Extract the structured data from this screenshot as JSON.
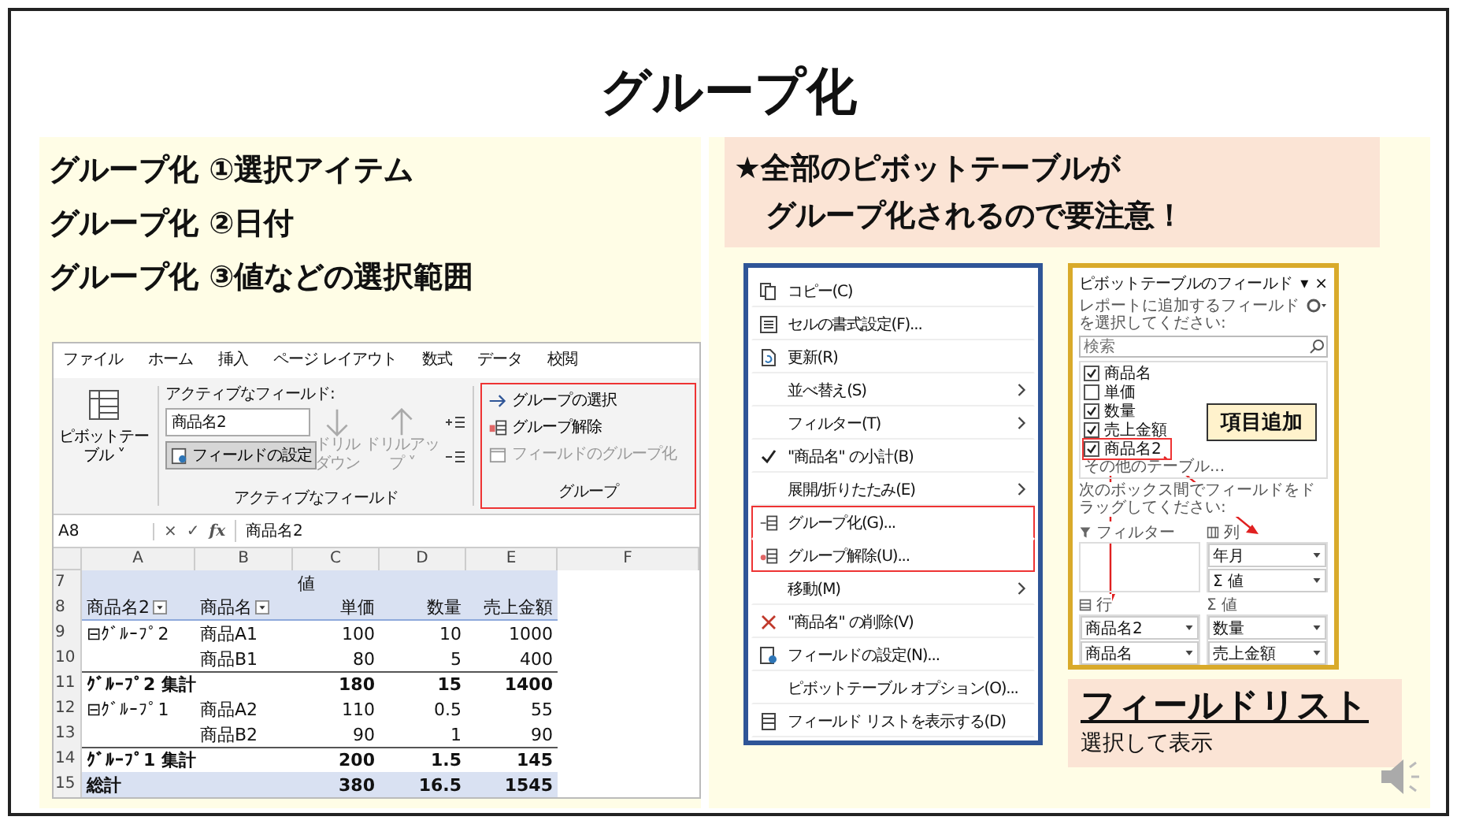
{
  "title": "グループ化",
  "points": [
    "グループ化 ①選択アイテム",
    "グループ化 ②日付",
    "グループ化 ③値などの選択範囲"
  ],
  "notice": [
    "★全部のピボットテーブルが",
    "グループ化されるので要注意！"
  ],
  "ribbon": {
    "tabs": [
      "ファイル",
      "ホーム",
      "挿入",
      "ページ レイアウト",
      "数式",
      "データ",
      "校閲"
    ],
    "pivot_button": [
      "ピボットテー",
      "ブル ˅"
    ],
    "active_field_label": "アクティブなフィールド:",
    "active_field_value": "商品名2",
    "field_settings": "フィールドの設定",
    "drill_down": [
      "ドリル",
      "ダウン"
    ],
    "drill_up": [
      "ドリルアッ",
      "プ ˅"
    ],
    "active_group_label": "アクティブなフィールド",
    "group_commands": [
      {
        "label": "グループの選択",
        "kind": "select",
        "disabled": false
      },
      {
        "label": "グループ解除",
        "kind": "ungroup",
        "disabled": false
      },
      {
        "label": "フィールドのグループ化",
        "kind": "group",
        "disabled": true
      }
    ],
    "group_label": "グループ"
  },
  "formula_bar": {
    "name_box": "A8",
    "cancel": "×",
    "enter": "✓",
    "function": "fx",
    "formula": "商品名2"
  },
  "sheet": {
    "columns": [
      "A",
      "B",
      "C",
      "D",
      "E",
      "F"
    ],
    "rows": [
      {
        "number": "7",
        "kind": "band",
        "cells": [
          null,
          null,
          {
            "text": "値"
          },
          null,
          null
        ]
      },
      {
        "number": "8",
        "kind": "header",
        "cells": [
          {
            "text": "商品名2",
            "dropdown": true
          },
          {
            "text": "商品名",
            "dropdown": true
          },
          {
            "text": "単価"
          },
          {
            "text": "数量"
          },
          {
            "text": "売上金額"
          }
        ]
      },
      {
        "number": "9",
        "kind": "item",
        "cells": [
          {
            "text": "⊟ｸﾞﾙｰﾌﾟ2"
          },
          {
            "text": "商品A1"
          },
          {
            "text": "100"
          },
          {
            "text": "10"
          },
          {
            "text": "1000"
          }
        ]
      },
      {
        "number": "10",
        "kind": "item",
        "cells": [
          null,
          {
            "text": "商品B1"
          },
          {
            "text": "80"
          },
          {
            "text": "5"
          },
          {
            "text": "400"
          }
        ]
      },
      {
        "number": "11",
        "kind": "subtotal",
        "cells": [
          {
            "text": "ｸﾞﾙｰﾌﾟ2 集計"
          },
          null,
          {
            "text": "180"
          },
          {
            "text": "15"
          },
          {
            "text": "1400"
          }
        ]
      },
      {
        "number": "12",
        "kind": "item",
        "cells": [
          {
            "text": "⊟ｸﾞﾙｰﾌﾟ1"
          },
          {
            "text": "商品A2"
          },
          {
            "text": "110"
          },
          {
            "text": "0.5"
          },
          {
            "text": "55"
          }
        ]
      },
      {
        "number": "13",
        "kind": "item",
        "cells": [
          null,
          {
            "text": "商品B2"
          },
          {
            "text": "90"
          },
          {
            "text": "1"
          },
          {
            "text": "90"
          }
        ]
      },
      {
        "number": "14",
        "kind": "subtotal",
        "cells": [
          {
            "text": "ｸﾞﾙｰﾌﾟ1 集計"
          },
          null,
          {
            "text": "200"
          },
          {
            "text": "1.5"
          },
          {
            "text": "145"
          }
        ]
      },
      {
        "number": "15",
        "kind": "total",
        "cells": [
          {
            "text": "総計"
          },
          null,
          {
            "text": "380"
          },
          {
            "text": "16.5"
          },
          {
            "text": "1545"
          }
        ]
      }
    ]
  },
  "context_menu": [
    {
      "label": "コピー(C)",
      "kind": "copy",
      "checked": false,
      "submenu": false,
      "highlighted": false
    },
    {
      "label": "セルの書式設定(F)...",
      "kind": "format",
      "checked": false,
      "submenu": false,
      "highlighted": false
    },
    {
      "label": "更新(R)",
      "kind": "refresh",
      "checked": false,
      "submenu": false,
      "highlighted": false
    },
    {
      "label": "並べ替え(S)",
      "kind": "plain",
      "checked": false,
      "submenu": true,
      "highlighted": false
    },
    {
      "label": "フィルター(T)",
      "kind": "plain",
      "checked": false,
      "submenu": true,
      "highlighted": false
    },
    {
      "label": "\"商品名\" の小計(B)",
      "kind": "plain",
      "checked": true,
      "submenu": false,
      "highlighted": false
    },
    {
      "label": "展開/折りたたみ(E)",
      "kind": "plain",
      "checked": false,
      "submenu": true,
      "highlighted": false
    },
    {
      "label": "グループ化(G)...",
      "kind": "group",
      "checked": false,
      "submenu": false,
      "highlighted": true
    },
    {
      "label": "グループ解除(U)...",
      "kind": "ungroup",
      "checked": false,
      "submenu": false,
      "highlighted": true
    },
    {
      "label": "移動(M)",
      "kind": "plain",
      "checked": false,
      "submenu": true,
      "highlighted": false
    },
    {
      "label": "\"商品名\" の削除(V)",
      "kind": "delete",
      "checked": false,
      "submenu": false,
      "highlighted": false
    },
    {
      "label": "フィールドの設定(N)...",
      "kind": "settings",
      "checked": false,
      "submenu": false,
      "highlighted": false
    },
    {
      "label": "ピボットテーブル オプション(O)...",
      "kind": "plain",
      "checked": false,
      "submenu": false,
      "highlighted": false
    },
    {
      "label": "フィールド リストを表示する(D)",
      "kind": "fieldlist",
      "checked": false,
      "submenu": false,
      "highlighted": false
    }
  ],
  "field_list": {
    "title": "ピボットテーブルのフィールド",
    "title_menu": "▾",
    "close": "×",
    "prompt": "レポートに追加するフィールドを選択してください:",
    "search_placeholder": "検索",
    "fields": [
      {
        "label": "商品名",
        "checked": true,
        "highlighted": false
      },
      {
        "label": "単価",
        "checked": false,
        "highlighted": false
      },
      {
        "label": "数量",
        "checked": true,
        "highlighted": false
      },
      {
        "label": "売上金額",
        "checked": true,
        "highlighted": false
      },
      {
        "label": "商品名2",
        "checked": true,
        "highlighted": true
      }
    ],
    "more_tables": "その他のテーブル...",
    "drag_prompt": "次のボックス間でフィールドをドラッグしてください:",
    "areas": [
      {
        "kind": "filter",
        "label": "フィルター"
      },
      {
        "kind": "columns",
        "label": "列",
        "items": [
          "年月",
          "Σ 値"
        ]
      },
      {
        "kind": "rows",
        "label": "行",
        "items": [
          "商品名2",
          "商品名"
        ]
      },
      {
        "kind": "values",
        "label": "Σ 値",
        "items": [
          "数量",
          "売上金額"
        ]
      }
    ],
    "callout": "項目追加"
  },
  "field_list_note": {
    "title": "フィールドリスト",
    "caption": "選択して表示"
  }
}
